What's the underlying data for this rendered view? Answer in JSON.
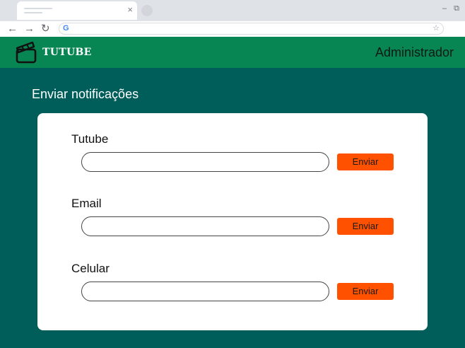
{
  "browser": {
    "tab_close": "×",
    "window_minimize": "–",
    "window_restore": "⧉",
    "nav_back": "←",
    "nav_forward": "→",
    "nav_reload": "↻",
    "omnibox_g": "G",
    "omnibox_star": "☆"
  },
  "header": {
    "brand": "TUTUBE",
    "user": "Administrador",
    "color": "#078552",
    "logo_icon": "clapperboard-icon"
  },
  "page": {
    "title": "Enviar notificações",
    "background": "#005e5a"
  },
  "fields": [
    {
      "label": "Tutube",
      "value": "",
      "button": "Enviar"
    },
    {
      "label": "Email",
      "value": "",
      "button": "Enviar"
    },
    {
      "label": "Celular",
      "value": "",
      "button": "Enviar"
    }
  ],
  "accent": "#ff5100"
}
